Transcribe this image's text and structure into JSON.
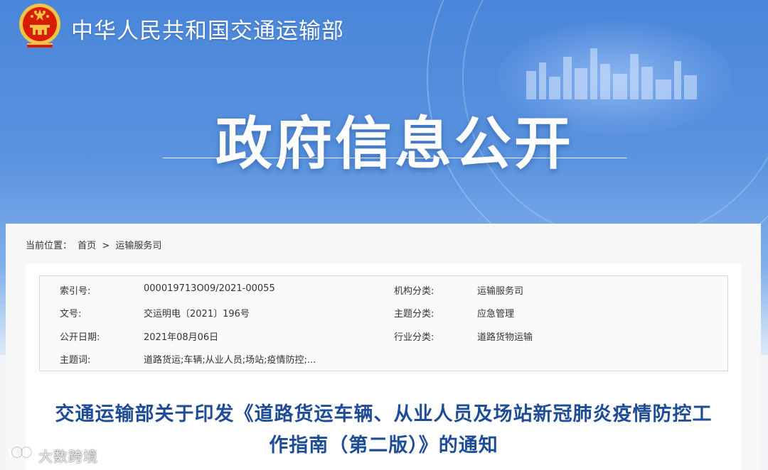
{
  "header": {
    "ministry_name": "中华人民共和国交通运输部",
    "banner_title": "政府信息公开"
  },
  "breadcrumb": {
    "prefix": "当前位置：",
    "home": "首页",
    "separator": ">",
    "current": "运输服务司"
  },
  "meta": {
    "rows": [
      {
        "label1": "索引号:",
        "value1": "000019713O09/2021-00055",
        "label2": "机构分类:",
        "value2": "运输服务司"
      },
      {
        "label1": "文号:",
        "value1": "交运明电〔2021〕196号",
        "label2": "主题分类:",
        "value2": "应急管理"
      },
      {
        "label1": "公开日期:",
        "value1": "2021年08月06日",
        "label2": "行业分类:",
        "value2": "道路货物运输"
      },
      {
        "label1": "主题词:",
        "value1": "道路货运;车辆;从业人员;场站;疫情防控;...",
        "label2": "",
        "value2": ""
      }
    ]
  },
  "article": {
    "title_line1": "交通运输部关于印发《道路货运车辆、从业人员及场站新冠肺炎疫情防控工",
    "title_line2": "作指南（第二版）》的通知"
  },
  "watermark": {
    "text": "大数跨境"
  },
  "colors": {
    "banner_blue": "#4a86d9",
    "title_blue": "#1f4c96",
    "emblem_red": "#d81e06",
    "emblem_gold": "#f6c445"
  }
}
